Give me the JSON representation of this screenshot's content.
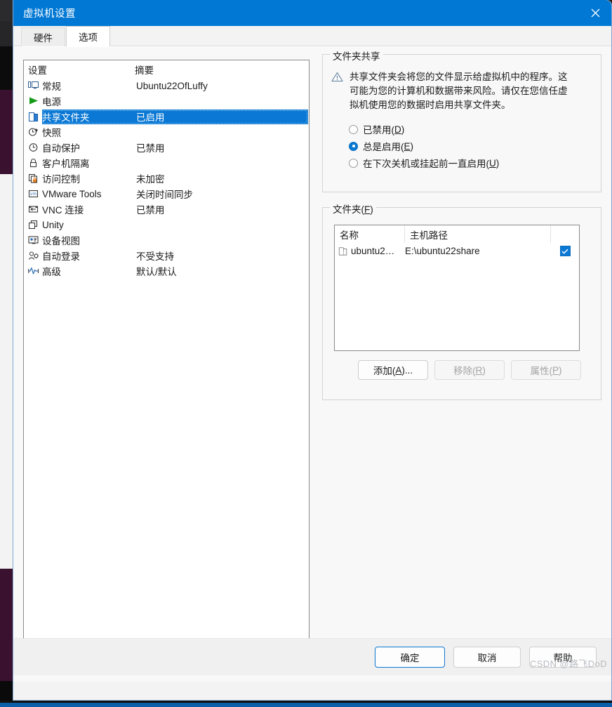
{
  "window": {
    "title": "虚拟机设置",
    "close_icon": "close-icon",
    "titlebar_color": "#0078d4"
  },
  "tabs": [
    {
      "label": "硬件",
      "active": false
    },
    {
      "label": "选项",
      "active": true
    }
  ],
  "settings_list": {
    "columns": [
      "设置",
      "摘要"
    ],
    "selected_index": 2,
    "rows": [
      {
        "icon": "monitor-icon",
        "label": "常规",
        "summary": "Ubuntu22OfLuffy"
      },
      {
        "icon": "play-icon",
        "label": "电源",
        "summary": ""
      },
      {
        "icon": "shared-folder-icon",
        "label": "共享文件夹",
        "summary": "已启用"
      },
      {
        "icon": "snapshot-clock-icon",
        "label": "快照",
        "summary": ""
      },
      {
        "icon": "autoprotect-clock-icon",
        "label": "自动保护",
        "summary": "已禁用"
      },
      {
        "icon": "lock-icon",
        "label": "客户机隔离",
        "summary": ""
      },
      {
        "icon": "access-control-icon",
        "label": "访问控制",
        "summary": "未加密"
      },
      {
        "icon": "vmware-tools-icon",
        "label": "VMware Tools",
        "summary": "关闭时间同步"
      },
      {
        "icon": "vnc-icon",
        "label": "VNC 连接",
        "summary": "已禁用"
      },
      {
        "icon": "unity-icon",
        "label": "Unity",
        "summary": ""
      },
      {
        "icon": "device-view-icon",
        "label": "设备视图",
        "summary": ""
      },
      {
        "icon": "auto-login-icon",
        "label": "自动登录",
        "summary": "不受支持"
      },
      {
        "icon": "advanced-icon",
        "label": "高级",
        "summary": "默认/默认"
      }
    ]
  },
  "folder_sharing": {
    "group_title": "文件夹共享",
    "warning_icon": "warning-triangle-icon",
    "warning_text": "共享文件夹会将您的文件显示给虚拟机中的程序。这可能为您的计算机和数据带来风险。请仅在您信任虚拟机使用您的数据时启用共享文件夹。",
    "options": [
      {
        "label": "已禁用(D)",
        "text": "已禁用(",
        "key": "D",
        "tail": ")",
        "selected": false
      },
      {
        "label": "总是启用(E)",
        "text": "总是启用(",
        "key": "E",
        "tail": ")",
        "selected": true
      },
      {
        "label": "在下次关机或挂起前一直启用(U)",
        "text": "在下次关机或挂起前一直启用(",
        "key": "U",
        "tail": ")",
        "selected": false
      }
    ]
  },
  "folders": {
    "group_title_text": "文件夹(",
    "group_title_key": "F",
    "group_title_tail": ")",
    "columns": [
      "名称",
      "主机路径",
      ""
    ],
    "rows": [
      {
        "icon": "shared-folder-icon",
        "name": "ubuntu2…",
        "host_path": "E:\\ubuntu22share",
        "enabled": true
      }
    ],
    "buttons": [
      {
        "text": "添加(",
        "key": "A",
        "tail": ")...",
        "disabled": false,
        "name": "add-folder-button"
      },
      {
        "text": "移除(",
        "key": "R",
        "tail": ")",
        "disabled": true,
        "name": "remove-folder-button"
      },
      {
        "text": "属性(",
        "key": "P",
        "tail": ")",
        "disabled": true,
        "name": "folder-properties-button"
      }
    ]
  },
  "footer": {
    "ok": "确定",
    "cancel": "取消",
    "help": "帮助"
  },
  "watermark": "CSDN @路飞DoD"
}
